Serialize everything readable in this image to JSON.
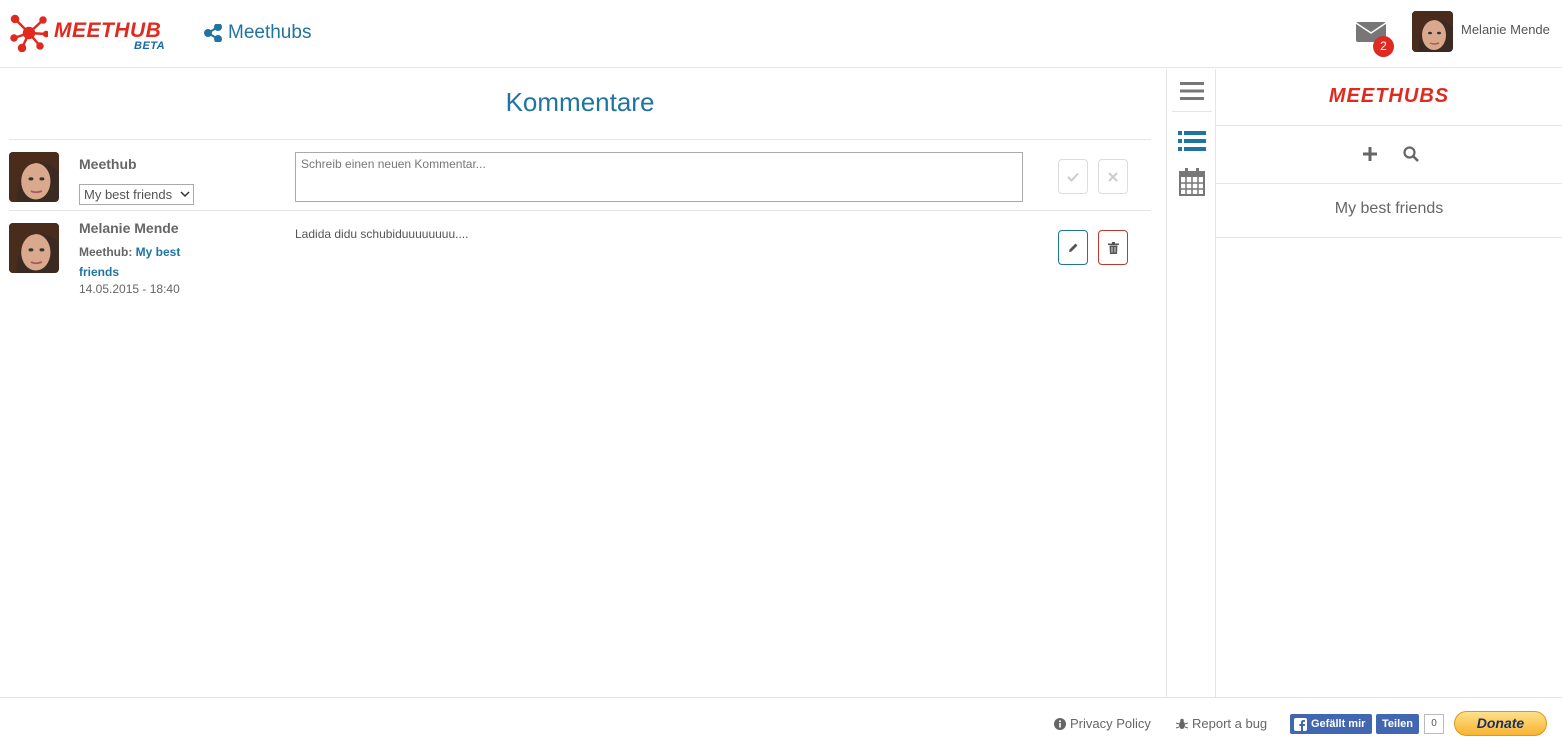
{
  "header": {
    "logo_text": "MEETHUB",
    "logo_badge": "BETA",
    "nav_label": "Meethubs",
    "mail_count": "2",
    "user_name": "Melanie Mende"
  },
  "main": {
    "title": "Kommentare",
    "new_comment": {
      "context_label": "Meethub",
      "selected_meethub": "My best friends",
      "placeholder": "Schreib einen neuen Kommentar..."
    },
    "comments": [
      {
        "author": "Melanie Mende",
        "meethub_prefix": "Meethub: ",
        "meethub_name": "My best friends",
        "timestamp": "14.05.2015 - 18:40",
        "text": "Ladida didu schubiduuuuuuuu...."
      }
    ]
  },
  "right_panel": {
    "logo_text": "MEETHUBS",
    "items": [
      "My best friends"
    ]
  },
  "footer": {
    "privacy_label": "Privacy Policy",
    "bug_label": "Report a bug",
    "fb_like_label": "Gefällt mir",
    "fb_share_label": "Teilen",
    "fb_count": "0",
    "donate_label": "Donate"
  },
  "colors": {
    "brand_red": "#e0291f",
    "accent_blue": "#1f74a0"
  }
}
